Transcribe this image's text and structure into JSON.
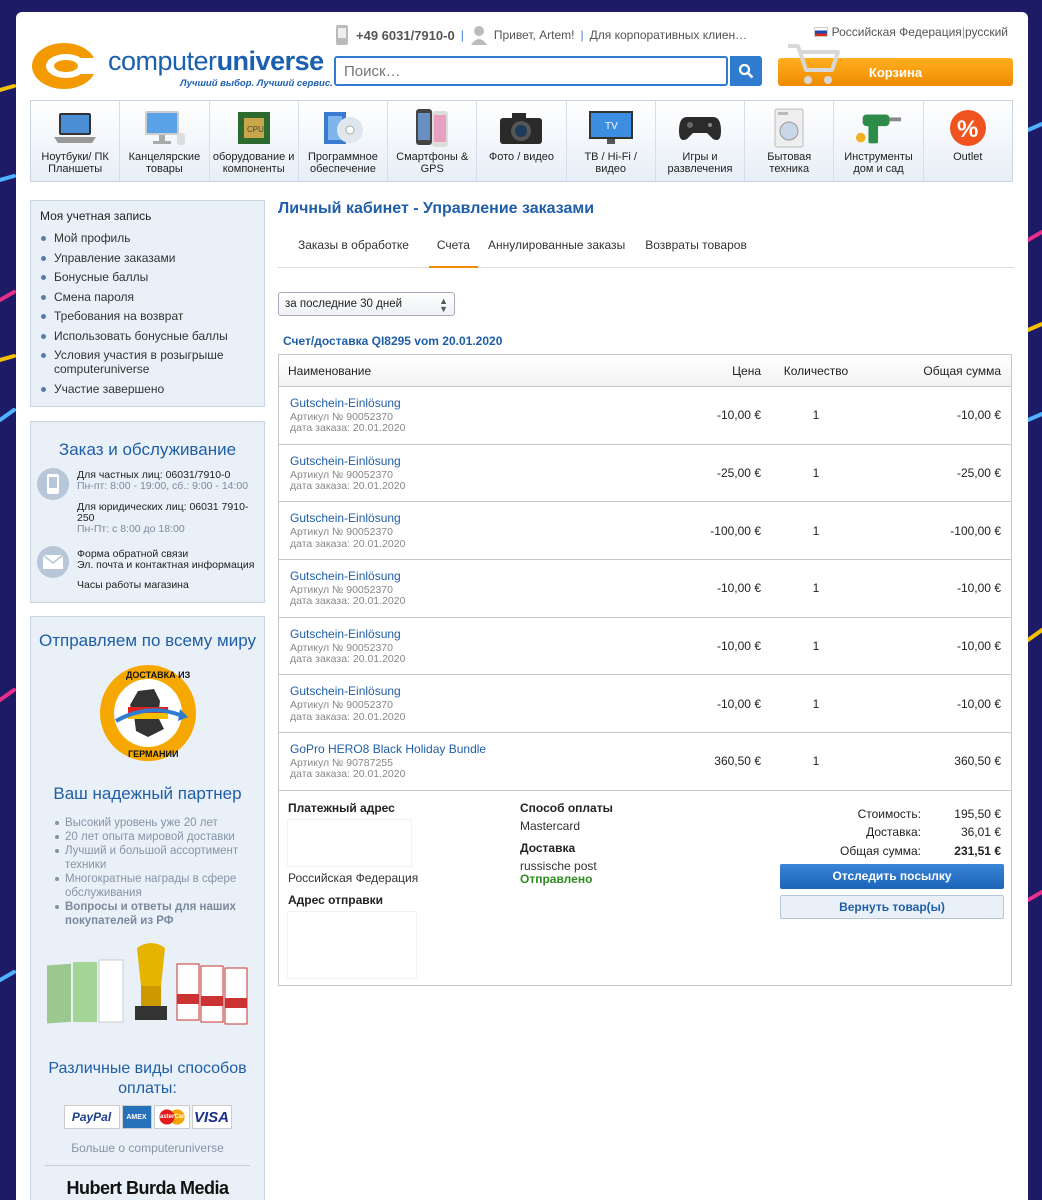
{
  "header": {
    "logo_text_light": "computer",
    "logo_text_bold": "universe",
    "tagline": "Лучший выбор. Лучший сервис.",
    "phone": "+49 6031/7910-0",
    "greeting": "Привет, Artem!",
    "corporate": "Для корпоративных клиен…",
    "country": "Российская Федерация",
    "language": "русский",
    "search_placeholder": "Поиск…",
    "cart_label": "Корзина"
  },
  "categories": [
    {
      "label": "Ноутбуки/ ПК Планшеты",
      "icon": "laptop-icon"
    },
    {
      "label": "Канцелярские товары",
      "icon": "desktop-icon"
    },
    {
      "label": "оборудование и компоненты",
      "icon": "cpu-icon"
    },
    {
      "label": "Программное обеспечение",
      "icon": "software-icon"
    },
    {
      "label": "Смартфоны & GPS",
      "icon": "smartphone-icon"
    },
    {
      "label": "Фото / видео",
      "icon": "camera-icon"
    },
    {
      "label": "ТВ / Hi-Fi / видео",
      "icon": "tv-icon"
    },
    {
      "label": "Игры и развлечения",
      "icon": "gamepad-icon"
    },
    {
      "label": "Бытовая техника",
      "icon": "washer-icon"
    },
    {
      "label": "Инструменты дом и сад",
      "icon": "drill-icon"
    },
    {
      "label": "Outlet",
      "icon": "percent-icon"
    }
  ],
  "account": {
    "title": "Моя учетная запись",
    "items": [
      "Мой профиль",
      "Управление заказами",
      "Бонусные баллы",
      "Смена пароля",
      "Требования на возврат",
      "Использовать бонусные баллы",
      "Условия участия в розыгрыше computeruniverse",
      "Участие завершено"
    ]
  },
  "service": {
    "title": "Заказ и обслуживание",
    "private_line": "Для частных лиц: 06031/7910-0",
    "private_hours": "Пн-пт: 8:00 - 19:00, сб.: 9:00 - 14:00",
    "business_line": "Для юридических лиц: 06031 7910-250",
    "business_hours": "Пн-Пт: с 8:00 до 18:00",
    "feedback": "Форма обратной связи",
    "contact": "Эл. почта и контактная информация",
    "hours": "Часы работы магазина"
  },
  "world": {
    "title": "Отправляем по всему миру",
    "badge_top": "ДОСТАВКА ИЗ",
    "badge_bottom": "ГЕРМАНИИ",
    "partner_title": "Ваш надежный партнер",
    "points": [
      {
        "text": "Высокий уровень уже 20 лет",
        "bold": false
      },
      {
        "text": "20 лет опыта мировой доставки",
        "bold": false
      },
      {
        "text": "Лучший и большой ассортимент техники",
        "bold": false
      },
      {
        "text": "Многократные награды в сфере обслуживания",
        "bold": false
      },
      {
        "text": "Вопросы и ответы для наших покупателей из РФ",
        "bold": true
      }
    ],
    "pay_title": "Различные виды способов оплаты:",
    "pay_methods": [
      "PayPal",
      "AMEX",
      "MasterCard",
      "VISA"
    ],
    "more": "Больше о computeruniverse",
    "brand": "Hubert Burda Media"
  },
  "main": {
    "title": "Личный кабинет - Управление заказами",
    "tabs": [
      "Заказы в обработке",
      "Счета",
      "Аннулированные заказы",
      "Возвраты товаров"
    ],
    "active_tab": 1,
    "period": "за последние 30 дней",
    "invoice_title": "Счет/доставка QI8295 vom 20.01.2020",
    "columns": {
      "name": "Наименование",
      "price": "Цена",
      "qty": "Количество",
      "total": "Общая сумма"
    },
    "rows": [
      {
        "name": "Gutschein-Einlösung",
        "article": "Артикул № 90052370",
        "date": "дата заказа: 20.01.2020",
        "price": "-10,00 €",
        "qty": "1",
        "total": "-10,00 €"
      },
      {
        "name": "Gutschein-Einlösung",
        "article": "Артикул № 90052370",
        "date": "дата заказа: 20.01.2020",
        "price": "-25,00 €",
        "qty": "1",
        "total": "-25,00 €"
      },
      {
        "name": "Gutschein-Einlösung",
        "article": "Артикул № 90052370",
        "date": "дата заказа: 20.01.2020",
        "price": "-100,00 €",
        "qty": "1",
        "total": "-100,00 €"
      },
      {
        "name": "Gutschein-Einlösung",
        "article": "Артикул № 90052370",
        "date": "дата заказа: 20.01.2020",
        "price": "-10,00 €",
        "qty": "1",
        "total": "-10,00 €"
      },
      {
        "name": "Gutschein-Einlösung",
        "article": "Артикул № 90052370",
        "date": "дата заказа: 20.01.2020",
        "price": "-10,00 €",
        "qty": "1",
        "total": "-10,00 €"
      },
      {
        "name": "Gutschein-Einlösung",
        "article": "Артикул № 90052370",
        "date": "дата заказа: 20.01.2020",
        "price": "-10,00 €",
        "qty": "1",
        "total": "-10,00 €"
      },
      {
        "name": "GoPro HERO8 Black Holiday Bundle",
        "article": "Артикул № 90787255",
        "date": "дата заказа: 20.01.2020",
        "price": "360,50 €",
        "qty": "1",
        "total": "360,50 €"
      }
    ],
    "billing_label": "Платежный адрес",
    "billing_country": "Российская Федерация",
    "shipping_label": "Адрес отправки",
    "payment_label": "Способ оплаты",
    "payment_value": "Mastercard",
    "delivery_label": "Доставка",
    "delivery_value": "russische post",
    "delivery_status": "Отправлено",
    "cost_label": "Стоимость:",
    "cost_value": "195,50 €",
    "shipping_cost_label": "Доставка:",
    "shipping_cost_value": "36,01 €",
    "sum_label": "Общая сумма:",
    "sum_value": "231,51 €",
    "track_button": "Отследить посылку",
    "return_button": "Вернуть товар(ы)"
  },
  "colors": {
    "brand_blue": "#1f5ea8",
    "brand_orange": "#f08a00",
    "status_green": "#2e8b1f",
    "background": "#1d1a66"
  }
}
